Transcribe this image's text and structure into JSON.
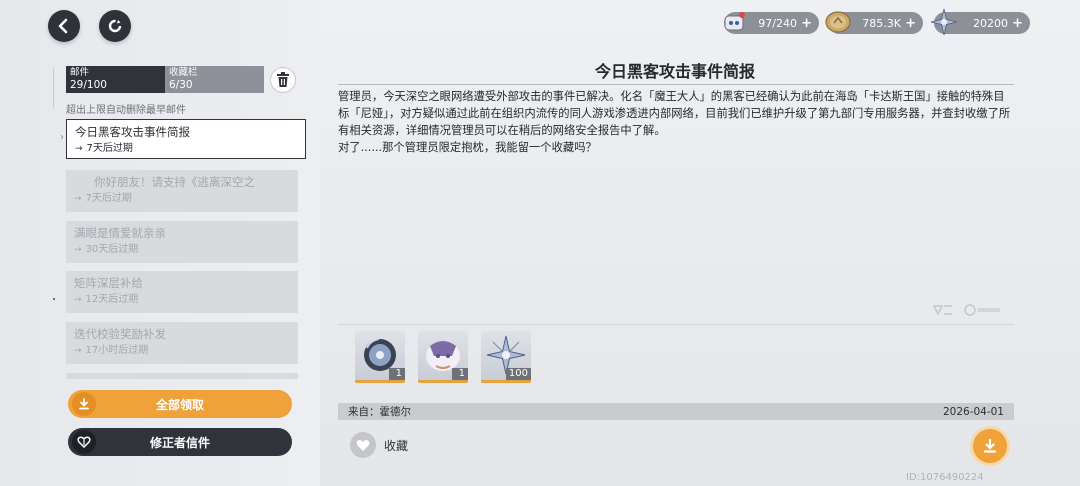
{
  "header": {
    "back_icon": "arrow-left-icon",
    "refresh_icon": "refresh-icon"
  },
  "currencies": [
    {
      "icon": "stamina-robot-icon",
      "value": "97/240",
      "plus": "+"
    },
    {
      "icon": "coin-icon",
      "value": "785.3K",
      "plus": "+"
    },
    {
      "icon": "crystal-star-icon",
      "value": "20200",
      "plus": "+"
    }
  ],
  "tabs": {
    "mail_label": "邮件",
    "mail_count": "29/100",
    "fav_label": "收藏栏",
    "fav_count": "6/30"
  },
  "note": "超出上限自动删除最早邮件",
  "mails": [
    {
      "title": "今日黑客攻击事件简报",
      "expire": "7天后过期",
      "active": true
    },
    {
      "title": "你好朋友！请支持《逃离深空之",
      "expire": "7天后过期",
      "active": false
    },
    {
      "title": "满眼是情爱就亲亲",
      "expire": "30天后过期",
      "active": false
    },
    {
      "title": "矩阵深层补给",
      "expire": "12天后过期",
      "active": false
    },
    {
      "title": "迭代校验奖励补发",
      "expire": "17小时后过期",
      "active": false
    }
  ],
  "expire_arrow": "→",
  "buttons": {
    "claim_all": "全部领取",
    "corrector_letter": "修正者信件"
  },
  "message": {
    "title": "今日黑客攻击事件简报",
    "body": "管理员，今天深空之眼网络遭受外部攻击的事件已解决。化名「魔王大人」的黑客已经确认为此前在海岛「卡达斯王国」接触的特殊目标「尼娅」，对方疑似通过此前在组织内流传的同人游戏渗透进内部网络，目前我们已维护升级了第九部门专用服务器，并查封收缴了所有相关资源，详细情况管理员可以在稍后的网络安全报告中了解。\n对了......那个管理员限定抱枕，我能留一个收藏吗？",
    "from_label": "来自：霍德尔",
    "date": "2026-04-01",
    "fav_label": "收藏"
  },
  "attachments": [
    {
      "icon": "disc-item-icon",
      "qty": "1"
    },
    {
      "icon": "pillow-item-icon",
      "qty": "1"
    },
    {
      "icon": "crystal-star-icon",
      "qty": "100"
    }
  ],
  "id_text": "ID:1076490224",
  "colors": {
    "accent_orange": "#f0a23a",
    "dark": "#30333a",
    "panel_bg": "#e6e8ec"
  }
}
